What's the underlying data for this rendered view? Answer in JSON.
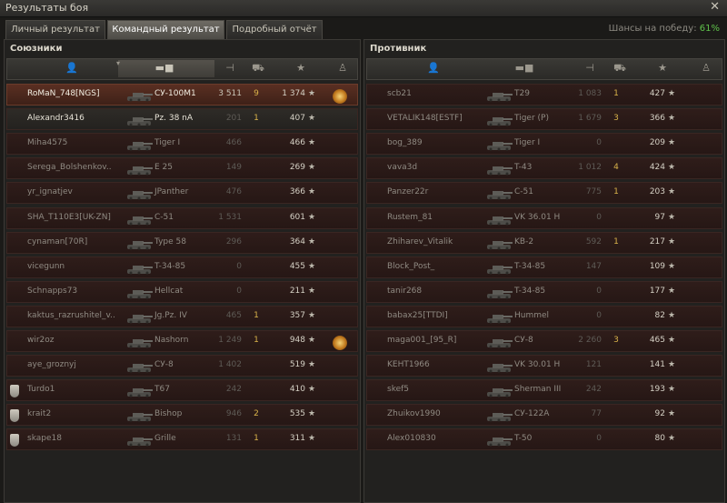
{
  "window": {
    "title": "Результаты боя",
    "close": "✕"
  },
  "tabs": [
    "Личный результат",
    "Командный результат",
    "Подробный отчёт"
  ],
  "chance": {
    "label": "Шансы на победу:",
    "value": "61%"
  },
  "allies": {
    "title": "Союзники",
    "players": [
      {
        "name": "RoMaN_748[NGS]",
        "tank": "СУ-100М1",
        "damage": "3 511",
        "kills": "9",
        "xp": "1 374",
        "medal": true,
        "self": true
      },
      {
        "name": "Alexandr3416",
        "tank": "Pz. 38 nA",
        "damage": "201",
        "kills": "1",
        "xp": "407",
        "plat": true
      },
      {
        "name": "Miha4575",
        "tank": "Tiger I",
        "damage": "466",
        "kills": "",
        "xp": "466"
      },
      {
        "name": "Serega_Bolshenkov..",
        "tank": "E 25",
        "damage": "149",
        "kills": "",
        "xp": "269"
      },
      {
        "name": "yr_ignatjev",
        "tank": "JPanther",
        "damage": "476",
        "kills": "",
        "xp": "366"
      },
      {
        "name": "SHA_T110E3[UK-ZN]",
        "tank": "C-51",
        "damage": "1 531",
        "kills": "",
        "xp": "601"
      },
      {
        "name": "cynaman[70R]",
        "tank": "Type 58",
        "damage": "296",
        "kills": "",
        "xp": "364"
      },
      {
        "name": "vicegunn",
        "tank": "T-34-85",
        "damage": "0",
        "kills": "",
        "xp": "455"
      },
      {
        "name": "Schnapps73",
        "tank": "Hellcat",
        "damage": "0",
        "kills": "",
        "xp": "211"
      },
      {
        "name": "kaktus_razrushitel_v..",
        "tank": "Jg.Pz. IV",
        "damage": "465",
        "kills": "1",
        "xp": "357"
      },
      {
        "name": "wir2oz",
        "tank": "Nashorn",
        "damage": "1 249",
        "kills": "1",
        "xp": "948",
        "medal": true
      },
      {
        "name": "aye_groznyj",
        "tank": "СУ-8",
        "damage": "1 402",
        "kills": "",
        "xp": "519"
      },
      {
        "name": "Turdo1",
        "tank": "T67",
        "damage": "242",
        "kills": "",
        "xp": "410",
        "platoon": true
      },
      {
        "name": "krait2",
        "tank": "Bishop",
        "damage": "946",
        "kills": "2",
        "xp": "535",
        "platoon": true
      },
      {
        "name": "skape18",
        "tank": "Grille",
        "damage": "131",
        "kills": "1",
        "xp": "311",
        "platoon": true
      }
    ]
  },
  "enemies": {
    "title": "Противник",
    "players": [
      {
        "name": "scb21",
        "tank": "T29",
        "damage": "1 083",
        "kills": "1",
        "xp": "427"
      },
      {
        "name": "VETALIK148[ESTF]",
        "tank": "Tiger (P)",
        "damage": "1 679",
        "kills": "3",
        "xp": "366"
      },
      {
        "name": "bog_389",
        "tank": "Tiger I",
        "damage": "0",
        "kills": "",
        "xp": "209"
      },
      {
        "name": "vava3d",
        "tank": "T-43",
        "damage": "1 012",
        "kills": "4",
        "xp": "424"
      },
      {
        "name": "Panzer22r",
        "tank": "C-51",
        "damage": "775",
        "kills": "1",
        "xp": "203"
      },
      {
        "name": "Rustem_81",
        "tank": "VK 36.01 H",
        "damage": "0",
        "kills": "",
        "xp": "97"
      },
      {
        "name": "Zhiharev_Vitalik",
        "tank": "KB-2",
        "damage": "592",
        "kills": "1",
        "xp": "217"
      },
      {
        "name": "Block_Post_",
        "tank": "T-34-85",
        "damage": "147",
        "kills": "",
        "xp": "109"
      },
      {
        "name": "tanir268",
        "tank": "T-34-85",
        "damage": "0",
        "kills": "",
        "xp": "177"
      },
      {
        "name": "babax25[TTDI]",
        "tank": "Hummel",
        "damage": "0",
        "kills": "",
        "xp": "82"
      },
      {
        "name": "maga001_[95_R]",
        "tank": "СУ-8",
        "damage": "2 260",
        "kills": "3",
        "xp": "465"
      },
      {
        "name": "KEHT1966",
        "tank": "VK 30.01 H",
        "damage": "121",
        "kills": "",
        "xp": "141"
      },
      {
        "name": "skef5",
        "tank": "Sherman III",
        "damage": "242",
        "kills": "",
        "xp": "193"
      },
      {
        "name": "Zhuikov1990",
        "tank": "СУ-122А",
        "damage": "77",
        "kills": "",
        "xp": "92"
      },
      {
        "name": "Alex010830",
        "tank": "T-50",
        "damage": "0",
        "kills": "",
        "xp": "80"
      }
    ]
  },
  "star": "★",
  "colors": {
    "chance": "#5fc14a",
    "kills": "#d8b24a",
    "selfRow": "#5a2f22"
  }
}
